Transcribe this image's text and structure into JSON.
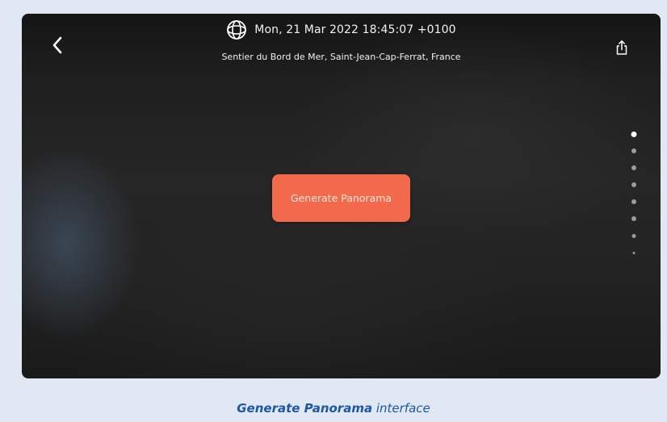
{
  "header": {
    "datetime": "Mon, 21 Mar 2022 18:45:07 +0100",
    "location": "Sentier du Bord de Mer, Saint-Jean-Cap-Ferrat, France",
    "icons": {
      "back": "chevron-left-icon",
      "globe": "globe-icon",
      "share": "share-icon"
    }
  },
  "main": {
    "generate_button_label": "Generate Panorama",
    "accent_color": "#f26a4b"
  },
  "pager": {
    "dot_count": 8,
    "active_index": 0
  },
  "caption": {
    "strong": "Generate Panorama",
    "rest": " interface",
    "color": "#1e56a8"
  }
}
